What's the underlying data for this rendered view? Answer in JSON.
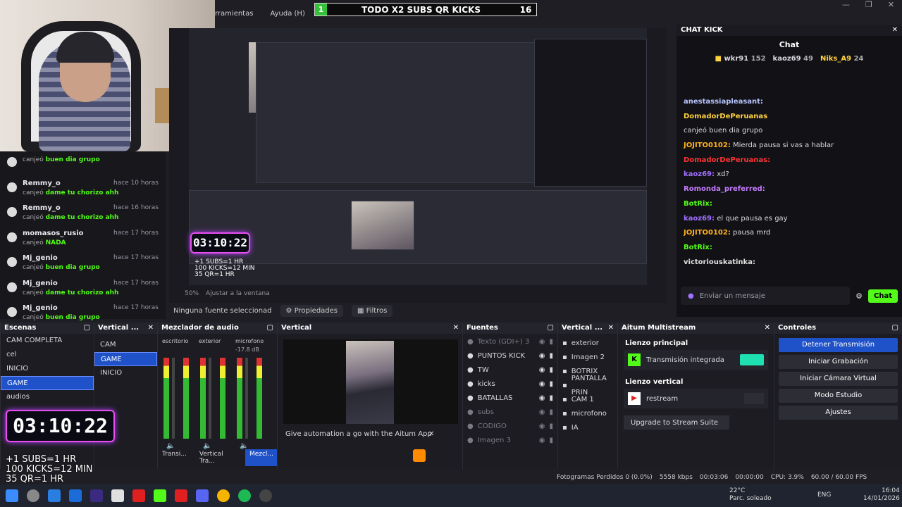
{
  "banner": {
    "badge": "1",
    "title": "TODO X2 SUBS QR KICKS",
    "count": "16"
  },
  "menu": {
    "items": [
      "rramientas",
      "Ayuda (H)"
    ]
  },
  "timer": {
    "value": "03:10:22"
  },
  "goals": [
    "+1 SUBS=1 HR",
    "100 KICKS=12 MIN",
    "35 QR=1 HR"
  ],
  "preview": {
    "zoom": "50%",
    "fit": "Ajustar a la ventana"
  },
  "source_bar": {
    "selected": "Ninguna fuente seleccionad",
    "props": "Propiedades",
    "filters": "Filtros"
  },
  "left_events": [
    {
      "user": "",
      "action_prefix": "canjeó",
      "action": "buen dia grupo",
      "time": ""
    },
    {
      "user": "Remmy_o",
      "action_prefix": "canjeó",
      "action": "dame tu chorizo ahh",
      "time": "hace 10 horas"
    },
    {
      "user": "Remmy_o",
      "action_prefix": "canjeó",
      "action": "dame tu chorizo ahh",
      "time": "hace 16 horas"
    },
    {
      "user": "momasos_rusio",
      "action_prefix": "canjeó",
      "action": "NADA",
      "time": "hace 17 horas"
    },
    {
      "user": "Mj_genio",
      "action_prefix": "canjeó",
      "action": "buen dia grupo",
      "time": "hace 17 horas"
    },
    {
      "user": "Mj_genio",
      "action_prefix": "canjeó",
      "action": "dame tu chorizo ahh",
      "time": "hace 17 horas"
    },
    {
      "user": "Mj_genio",
      "action_prefix": "canjeó",
      "action": "buen dia grupo",
      "time": "hace 17 horas"
    }
  ],
  "chat": {
    "dock_title": "CHAT KICK",
    "title": "Chat",
    "top": [
      {
        "name": "wkr91",
        "score": "152"
      },
      {
        "name": "kaoz69",
        "score": "49"
      },
      {
        "name": "Niks_A9",
        "score": "24"
      }
    ],
    "lines": [
      {
        "user": "anestassiapleasant:",
        "text": "",
        "color": "#b8c4ff"
      },
      {
        "user": "DomadorDePeruanas",
        "text": "",
        "color": "#ffd23f"
      },
      {
        "user": "",
        "text": "canjeó buen dia grupo",
        "color": "#e0e0e0"
      },
      {
        "user": "JOJITO0102:",
        "text": "Mierda pausa si vas a hablar",
        "color": "#ffb020"
      },
      {
        "user": "DomadorDePeruanas:",
        "text": "",
        "color": "#ff3333"
      },
      {
        "user": "kaoz69:",
        "text": "xd?",
        "color": "#a070ff"
      },
      {
        "user": "Romonda_preferred:",
        "text": "",
        "color": "#c47aff"
      },
      {
        "user": "BotRix:",
        "text": "",
        "color": "#53fc18"
      },
      {
        "user": "kaoz69:",
        "text": "el que pausa es gay",
        "color": "#a070ff"
      },
      {
        "user": "JOJITO0102:",
        "text": "pausa mrd",
        "color": "#ffb020"
      },
      {
        "user": "BotRix:",
        "text": "",
        "color": "#53fc18"
      },
      {
        "user": "victoriouskatinka:",
        "text": "",
        "color": "#e0e0e0"
      }
    ],
    "placeholder": "Enviar un mensaje",
    "send": "Chat"
  },
  "scenes": {
    "title": "Escenas",
    "items": [
      "CAM COMPLETA",
      "cel",
      "INICIO",
      "GAME",
      "audios"
    ],
    "selected": 3
  },
  "vertical_scenes": {
    "title": "Vertical ...",
    "items": [
      "CAM",
      "GAME",
      "INICIO"
    ],
    "selected": 1
  },
  "mixer": {
    "title": "Mezclador de audio",
    "channels": [
      {
        "name": "escritorio",
        "db": ""
      },
      {
        "name": "exterior",
        "db": ""
      },
      {
        "name": "microfono",
        "db": "-17.8 dB"
      }
    ],
    "tabs": [
      "Transi...",
      "Vertical Tra...",
      "Mezcl..."
    ]
  },
  "vertical_preview": {
    "title": "Vertical",
    "notice": "Give automation a go with the Aitum App"
  },
  "sources": {
    "title": "Fuentes",
    "items": [
      {
        "name": "Texto (GDI+) 3",
        "dim": true
      },
      {
        "name": "PUNTOS KICK",
        "dim": false
      },
      {
        "name": "TW",
        "dim": false
      },
      {
        "name": "kicks",
        "dim": false
      },
      {
        "name": "BATALLAS",
        "dim": false
      },
      {
        "name": "subs",
        "dim": true
      },
      {
        "name": "CODIGO",
        "dim": true
      },
      {
        "name": "Imagen 3",
        "dim": true
      }
    ]
  },
  "vertical_sources": {
    "title": "Vertical ...",
    "items": [
      "exterior",
      "Imagen 2",
      "BOTRIX",
      "PANTALLA PRIN",
      "CAM 1",
      "microfono",
      "IA"
    ]
  },
  "aitum": {
    "title": "Aitum Multistream",
    "main_label": "Lienzo principal",
    "main_output": "Transmisión integrada",
    "vertical_label": "Lienzo vertical",
    "vertical_output": "restream",
    "upgrade": "Upgrade to Stream Suite"
  },
  "controls": {
    "title": "Controles",
    "buttons": [
      "Detener Transmisión",
      "Iniciar Grabación",
      "Iniciar Cámara Virtual",
      "Modo Estudio",
      "Ajustes"
    ]
  },
  "status": {
    "frames": "Fotogramas Perdidos 0 (0.0%)",
    "bitrate": "5558 kbps",
    "live": "00:03:06",
    "rec": "00:00:00",
    "cpu": "CPU: 3.9%",
    "fps": "60.00 / 60.00 FPS"
  },
  "taskbar": {
    "temp": "22°C",
    "weather": "Parc. soleado",
    "lang": "ENG",
    "time": "16:04",
    "date": "14/01/2026"
  }
}
